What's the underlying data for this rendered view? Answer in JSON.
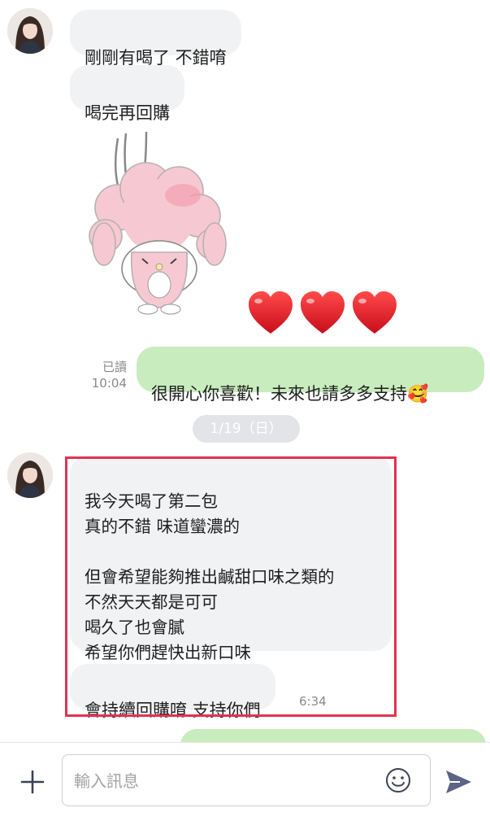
{
  "messages": {
    "m1": "剛剛有喝了  不錯唷",
    "m2": "喝完再回購",
    "sticker_name": "my-melody-sheep-sticker",
    "hearts_name": "three-red-hearts",
    "m3": "很開心你喜歡！未來也請多多支持",
    "m3_emoji": "🥰",
    "m3_read": "已讀",
    "m3_time": "10:04",
    "date": "1/19（日）",
    "m4": "我今天喝了第二包\n真的不錯 味道蠻濃的\n\n但會希望能夠推出鹹甜口味之類的\n不然天天都是可可\n喝久了也會膩\n希望你們趕快出新口味",
    "m5": "會持續回購唷 支持你們",
    "m5_time": "6:34"
  },
  "input": {
    "placeholder": "輸入訊息"
  },
  "colors": {
    "incoming_bubble": "#f1f2f4",
    "outgoing_bubble": "#c8ecbe",
    "highlight_border": "#e0334f",
    "send_icon": "#5c6383"
  }
}
